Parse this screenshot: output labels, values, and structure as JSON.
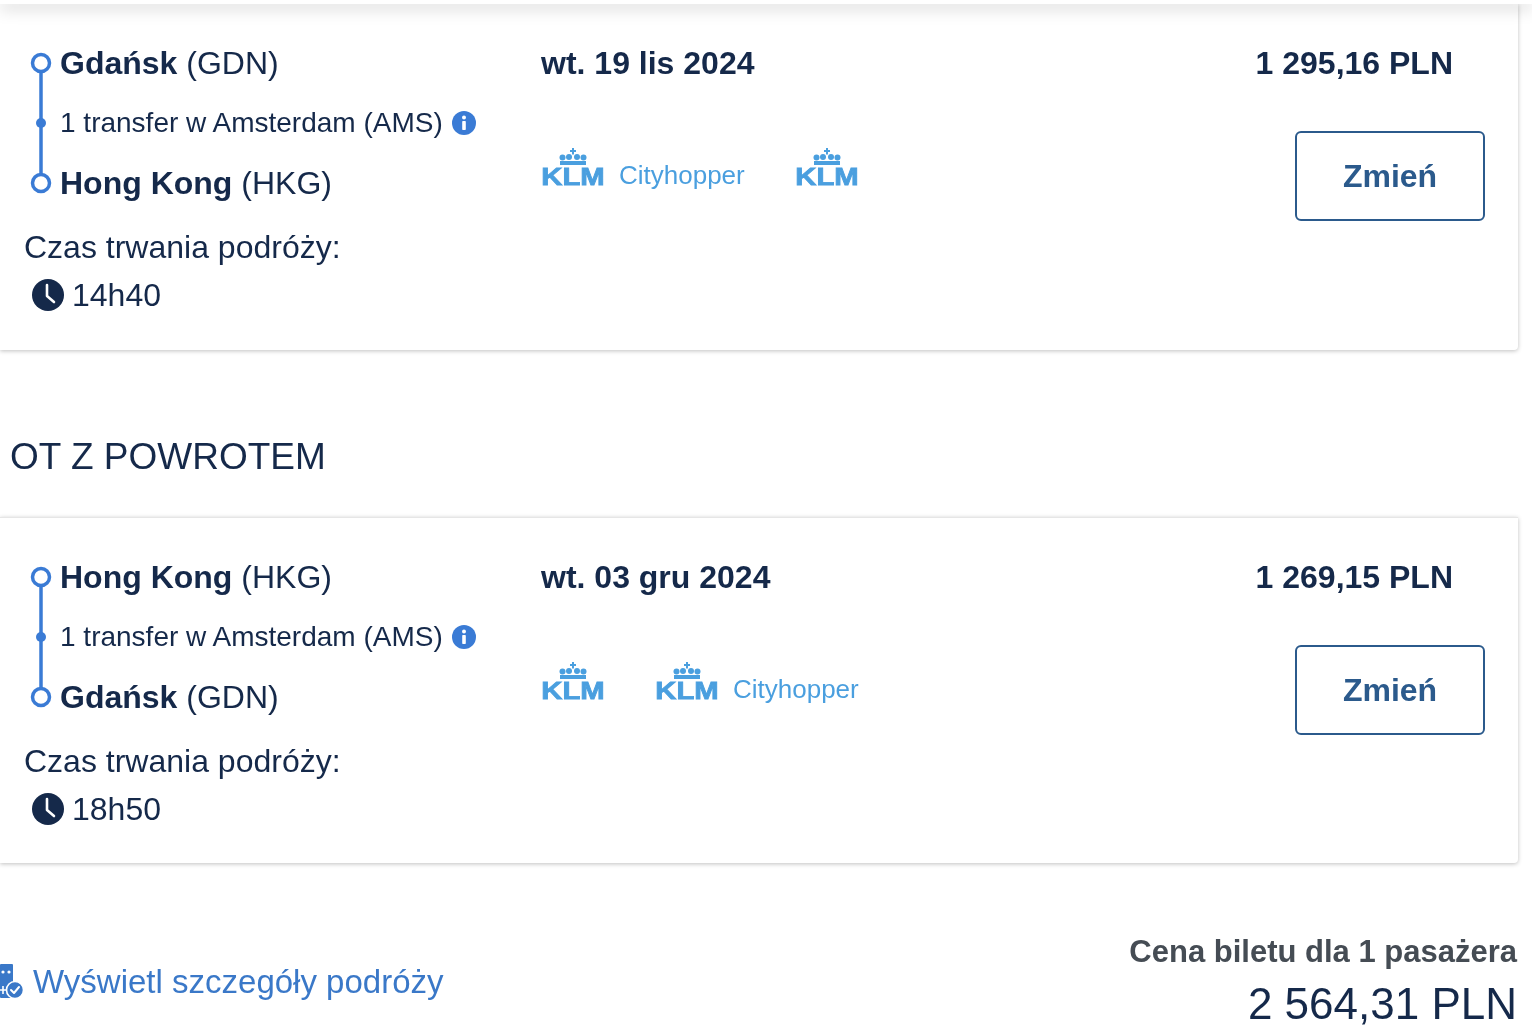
{
  "flights": [
    {
      "route": [
        {
          "kind": "stop",
          "label": "**Gdańsk** (GDN)"
        },
        {
          "kind": "transfer",
          "label": "1 transfer w Amsterdam (AMS)"
        },
        {
          "kind": "stop",
          "label": "**Hong Kong** (HKG)"
        }
      ],
      "duration_label": "Czas trwania podróży:",
      "duration": "14h40",
      "date": "wt. 19 lis 2024",
      "carriers": [
        {
          "logo": "KLM",
          "name": "Cityhopper"
        },
        {
          "logo": "KLM"
        }
      ],
      "price": "1 295,16 PLN",
      "button": "Zmień"
    },
    {
      "heading": "OT Z POWROTEM",
      "route": [
        {
          "kind": "stop",
          "label": "**Hong Kong** (HKG)"
        },
        {
          "kind": "transfer",
          "label": "1 transfer w Amsterdam (AMS)"
        },
        {
          "kind": "stop",
          "label": "**Gdańsk** (GDN)"
        }
      ],
      "duration_label": "Czas trwania podróży:",
      "duration": "18h50",
      "date": "wt. 03 gru 2024",
      "carriers": [
        {
          "logo": "KLM"
        },
        {
          "logo": "KLM",
          "name": "Cityhopper"
        }
      ],
      "price": "1 269,15 PLN",
      "button": "Zmień"
    }
  ],
  "footer": {
    "details_link": "Wyświetl szczegóły podróży",
    "price_label": "Cena biletu dla 1 pasażera",
    "total": "2 564,31 PLN"
  }
}
